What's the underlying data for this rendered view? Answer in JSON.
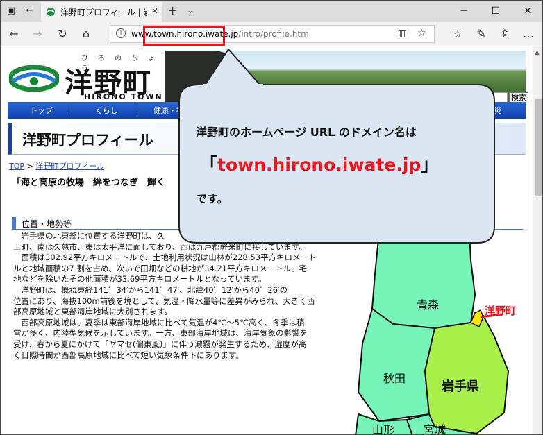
{
  "browser": {
    "tab_title": "洋野町プロフィール | 岩手県",
    "url_domain": "www.town.hirono.iwate.jp",
    "url_path": "/intro/profile.html",
    "info_glyph": "i"
  },
  "site": {
    "logo_ruby": "ひろのちょう",
    "logo_main": "洋野町",
    "logo_en": "HIRONO TOWN",
    "search_button": "検索",
    "menu": [
      "トップ",
      "くらし",
      "健康・福",
      "災"
    ]
  },
  "page": {
    "title": "洋野町プロフィール",
    "breadcrumb_top": "TOP",
    "breadcrumb_sep": ">",
    "breadcrumb_current": "洋野町プロフィール",
    "lead": "「海と高原の牧場　絆をつなぎ　輝く",
    "section_heading": "位置・地勢等",
    "paragraphs": [
      "岩手県の北東部に位置する洋野町は、久",
      "上町、南は久慈市、東は太平洋に面しており、西は九戸郡軽米町に接しています。",
      "面積は302.92平方キロメートルで、土地利用状況は山林が228.53平方キロメート",
      "ルと地域面積の7 割を占め、次いで田畑などの耕地が34.21平方キロメートル、宅",
      "地などを除いたその他面積が33.69平方キロメートルとなっています。",
      "洋野町は、概ね東経141゜34′から141゜47′、北緯40゜12′から40゜26′の",
      "位置にあり、海抜100m前後を境として、気温・降水量等に差異がみられ、大きく西",
      "部高原地域と東部海岸地域に大別されます。",
      "西部高原地域は、夏季は東部海岸地域に比べて気温が4℃～5℃高く、冬季は積",
      "雪が多く、内陸型気候を示しています。一方、東部海岸地域は、海岸気象の影響を",
      "受け、春から夏にかけて「ヤマセ(偏東風)」に伴う濃霧が発生するため、湿度が高",
      "く日照時間が西部高原地域に比べて短い気象条件下にあります。"
    ]
  },
  "map": {
    "aomori": "青森",
    "akita": "秋田",
    "iwate": "岩手県",
    "yamagata": "山形",
    "miyagi": "宮城",
    "hirono": "洋野町",
    "colors": {
      "iwate": "#a8f04a",
      "neighbors": "#77f5b8",
      "hirono": "#ffe400",
      "border": "#111111"
    }
  },
  "callout": {
    "line1": "洋野町のホームページ URL のドメイン名は",
    "open_bracket": "「",
    "domain": "town.hirono.iwate.jp",
    "close_bracket": "」",
    "line3": "です。",
    "highlight_color": "#e8161d"
  }
}
